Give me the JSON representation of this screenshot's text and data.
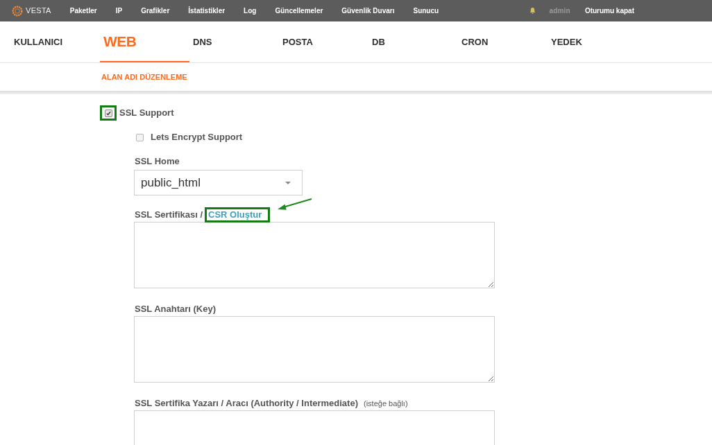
{
  "top_bar": {
    "logo": "VESTA",
    "menu": [
      "Paketler",
      "IP",
      "Grafikler",
      "İstatistikler",
      "Log",
      "Güncellemeler",
      "Güvenlik Duvarı",
      "Sunucu"
    ],
    "user": "admin",
    "logout": "Oturumu kapat"
  },
  "tabs": [
    {
      "label": "KULLANICI",
      "selected": false
    },
    {
      "label": "WEB",
      "selected": true
    },
    {
      "label": "DNS",
      "selected": false
    },
    {
      "label": "POSTA",
      "selected": false
    },
    {
      "label": "DB",
      "selected": false
    },
    {
      "label": "CRON",
      "selected": false
    },
    {
      "label": "YEDEK",
      "selected": false
    }
  ],
  "subnav": {
    "title": "ALAN ADI DÜZENLEME"
  },
  "form": {
    "ssl_support": {
      "label": "SSL Support",
      "checked": true,
      "highlighted": true
    },
    "lets_encrypt": {
      "label": "Lets Encrypt Support",
      "checked": false
    },
    "ssl_home": {
      "label": "SSL Home",
      "value": "public_html"
    },
    "fields": [
      {
        "label": "SSL Sertifikası /",
        "link": {
          "text": "CSR Oluştur",
          "highlighted": true
        }
      },
      {
        "label": "SSL Anahtarı (Key)"
      },
      {
        "label": "SSL Sertifika Yazarı / Aracı (Authority / Intermediate)",
        "note": "(isteğe bağlı)"
      }
    ]
  }
}
